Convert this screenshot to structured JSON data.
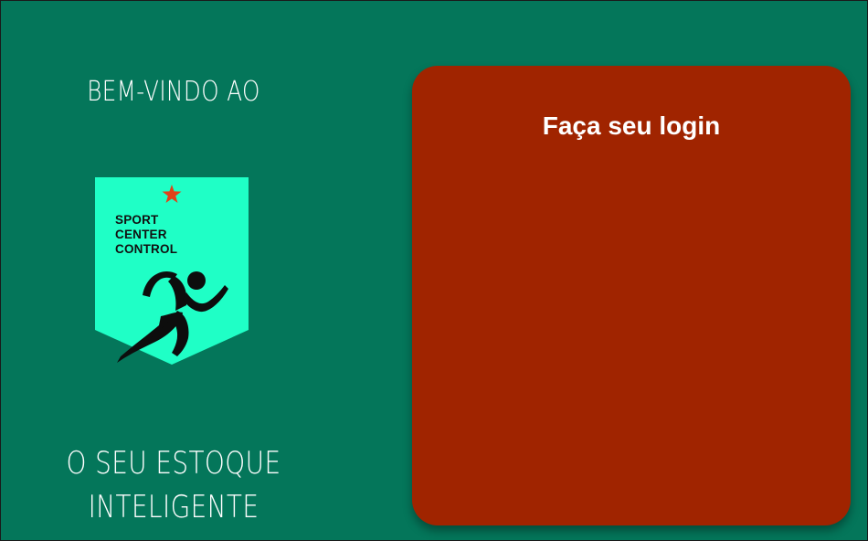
{
  "welcome": {
    "top_text": "BEM-VINDO AO",
    "bottom_line1": "O SEU ESTOQUE",
    "bottom_line2": "INTELIGENTE"
  },
  "logo": {
    "line1": "SPORT",
    "line2": "CENTER",
    "line3": "CONTROL",
    "icons": [
      "star-icon",
      "runner-icon"
    ]
  },
  "login": {
    "title": "Faça seu login"
  },
  "colors": {
    "background": "#04765a",
    "badge": "#1fffc6",
    "card": "#a02400",
    "star": "#e0421a"
  }
}
